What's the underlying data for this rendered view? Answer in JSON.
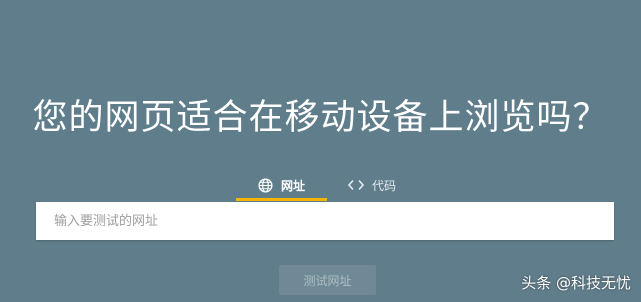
{
  "page": {
    "headline": "您的网页适合在移动设备上浏览吗？"
  },
  "tabs": {
    "url": {
      "label": "网址",
      "icon": "globe-icon",
      "selected": true
    },
    "code": {
      "label": "代码",
      "icon": "code-icon",
      "selected": false
    }
  },
  "search": {
    "placeholder": "输入要测试的网址",
    "value": ""
  },
  "actions": {
    "test_label": "测试网址"
  },
  "watermark": {
    "text": "头条 @科技无忧"
  },
  "colors": {
    "background": "#607d8b",
    "tab_indicator": "#f4b400",
    "button_disabled_bg": "#6f8a96",
    "button_disabled_text": "#aebdc4"
  }
}
